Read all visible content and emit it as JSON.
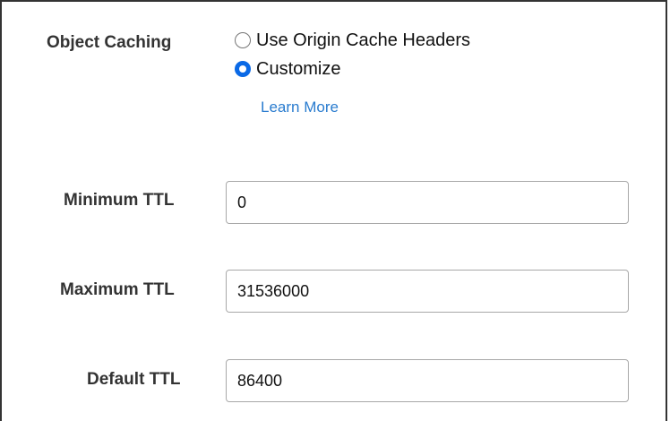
{
  "object_caching": {
    "label": "Object Caching",
    "options": [
      {
        "label": "Use Origin Cache Headers",
        "selected": false
      },
      {
        "label": "Customize",
        "selected": true
      }
    ],
    "learn_more": "Learn More"
  },
  "ttl": {
    "minimum": {
      "label": "Minimum TTL",
      "value": "0"
    },
    "maximum": {
      "label": "Maximum TTL",
      "value": "31536000"
    },
    "default": {
      "label": "Default TTL",
      "value": "86400"
    }
  },
  "colors": {
    "radio_selected": "#0a69e6",
    "link": "#2a7ccf",
    "label_text": "#333333"
  }
}
